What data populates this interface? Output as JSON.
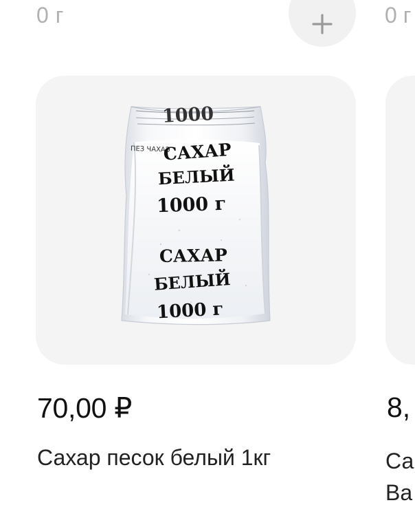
{
  "header": {
    "left_weight": "0 г",
    "right_weight": "0 г",
    "add_icon": "plus-icon"
  },
  "products": [
    {
      "image_text": {
        "top_label": "1000",
        "left_small_text": "ПЕЗ ЧАХАЭ",
        "line1": "САХАР",
        "line2": "БЕЛЫЙ",
        "line3": "1000 г",
        "line4": "САХАР",
        "line5": "БЕЛЫЙ",
        "line6": "1000 г"
      },
      "price": "70,00 ₽",
      "title": "Сахар песок белый 1кг"
    },
    {
      "price": "8,",
      "title": "Са\nВа"
    }
  ],
  "colors": {
    "card_background": "#f4f4f4",
    "muted_text": "#b0b0b0",
    "primary_text": "#111111"
  }
}
